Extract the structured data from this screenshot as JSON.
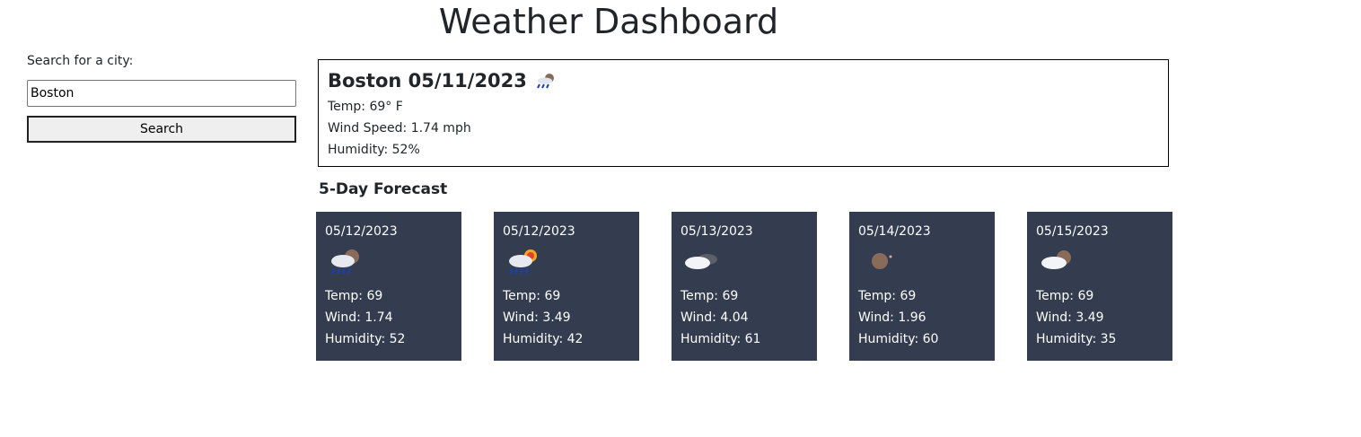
{
  "page": {
    "title": "Weather Dashboard"
  },
  "search": {
    "label": "Search for a city:",
    "input_value": "Boston",
    "button_label": "Search"
  },
  "current": {
    "heading": "Boston 05/11/2023",
    "icon": "moon-shower-icon",
    "temp": "Temp: 69° F",
    "wind": "Wind Speed: 1.74 mph",
    "humidity": "Humidity: 52%"
  },
  "forecast": {
    "heading": "5-Day Forecast",
    "days": [
      {
        "date": "05/12/2023",
        "icon": "rain-night-icon",
        "temp": "Temp: 69",
        "wind": "Wind: 1.74",
        "humidity": "Humidity: 52"
      },
      {
        "date": "05/12/2023",
        "icon": "rain-sun-icon",
        "temp": "Temp: 69",
        "wind": "Wind: 3.49",
        "humidity": "Humidity: 42"
      },
      {
        "date": "05/13/2023",
        "icon": "cloud-dark-icon",
        "temp": "Temp: 69",
        "wind": "Wind: 4.04",
        "humidity": "Humidity: 61"
      },
      {
        "date": "05/14/2023",
        "icon": "moon-icon",
        "temp": "Temp: 69",
        "wind": "Wind: 1.96",
        "humidity": "Humidity: 60"
      },
      {
        "date": "05/15/2023",
        "icon": "cloud-moon-icon",
        "temp": "Temp: 69",
        "wind": "Wind: 3.49",
        "humidity": "Humidity: 35"
      }
    ]
  },
  "colors": {
    "card_bg": "#343d4f",
    "card_text": "#ffffff"
  }
}
